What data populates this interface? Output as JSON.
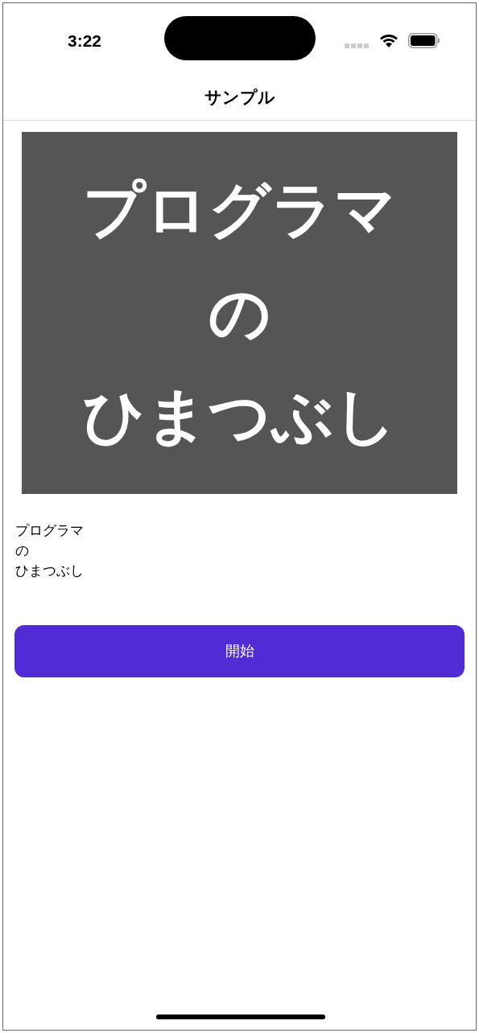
{
  "status_bar": {
    "time": "3:22"
  },
  "nav_bar": {
    "title": "サンプル"
  },
  "banner": {
    "lines": [
      "プログラマ",
      "の",
      "ひまつぶし"
    ]
  },
  "label": {
    "lines": [
      "プログラマ",
      "の",
      "ひまつぶし"
    ]
  },
  "buttons": [
    "開始"
  ]
}
